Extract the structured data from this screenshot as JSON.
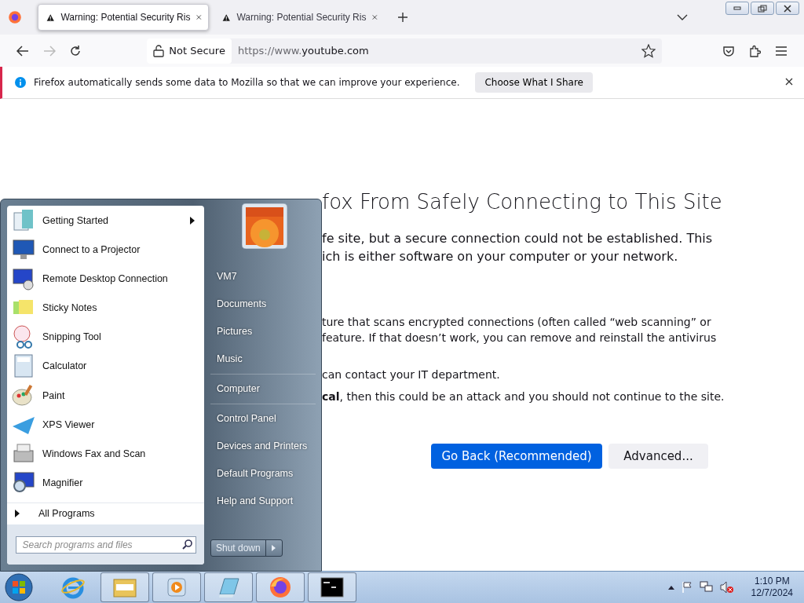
{
  "browser": {
    "tabs": [
      {
        "title": "Warning: Potential Security Ris",
        "selected": true
      },
      {
        "title": "Warning: Potential Security Ris",
        "selected": false
      }
    ],
    "address": {
      "security": "Not Secure",
      "prefix": "https://www.",
      "host": "youtube.com"
    }
  },
  "notification": {
    "message": "Firefox automatically sends some data to Mozilla so that we can improve your experience.",
    "button": "Choose What I Share"
  },
  "page": {
    "heading": "fox From Safely Connecting to This Site",
    "paragraphs": [
      {
        "lines": [
          "fe site, but a secure connection could not be established. This",
          "ich is either software on your computer or your network."
        ]
      },
      {
        "lines": [
          "ture that scans encrypted connections (often called “web scanning” or",
          "feature. If that doesn’t work, you can remove and reinstall the antivirus"
        ]
      },
      {
        "lines": [
          "can contact your IT department."
        ]
      },
      {
        "lines": [
          "**cal**, then this could be an attack and you should not continue to the site."
        ]
      }
    ],
    "primary_button": "Go Back (Recommended)",
    "secondary_button": "Advanced..."
  },
  "start_menu": {
    "programs": [
      {
        "label": "Getting Started",
        "has_submenu": true
      },
      {
        "label": "Connect to a Projector",
        "has_submenu": false
      },
      {
        "label": "Remote Desktop Connection",
        "has_submenu": false
      },
      {
        "label": "Sticky Notes",
        "has_submenu": false
      },
      {
        "label": "Snipping Tool",
        "has_submenu": false
      },
      {
        "label": "Calculator",
        "has_submenu": false
      },
      {
        "label": "Paint",
        "has_submenu": false
      },
      {
        "label": "XPS Viewer",
        "has_submenu": false
      },
      {
        "label": "Windows Fax and Scan",
        "has_submenu": false
      },
      {
        "label": "Magnifier",
        "has_submenu": false
      }
    ],
    "all_programs": "All Programs",
    "search_placeholder": "Search programs and files",
    "links": [
      {
        "label": "VM7",
        "separator_before": false
      },
      {
        "label": "Documents",
        "separator_before": false
      },
      {
        "label": "Pictures",
        "separator_before": false
      },
      {
        "label": "Music",
        "separator_before": false
      },
      {
        "label": "Computer",
        "separator_before": true
      },
      {
        "label": "Control Panel",
        "separator_before": true
      },
      {
        "label": "Devices and Printers",
        "separator_before": false
      },
      {
        "label": "Default Programs",
        "separator_before": false
      },
      {
        "label": "Help and Support",
        "separator_before": false
      }
    ],
    "shutdown": "Shut down"
  },
  "taskbar": {
    "items": [
      {
        "kind": "ie",
        "pinned_box": false
      },
      {
        "kind": "explorer",
        "pinned_box": true
      },
      {
        "kind": "media",
        "pinned_box": true
      },
      {
        "kind": "notepad",
        "pinned_box": true
      },
      {
        "kind": "firefox",
        "pinned_box": true
      },
      {
        "kind": "cmd",
        "pinned_box": true
      }
    ],
    "time": "1:10 PM",
    "date": "12/7/2024"
  }
}
